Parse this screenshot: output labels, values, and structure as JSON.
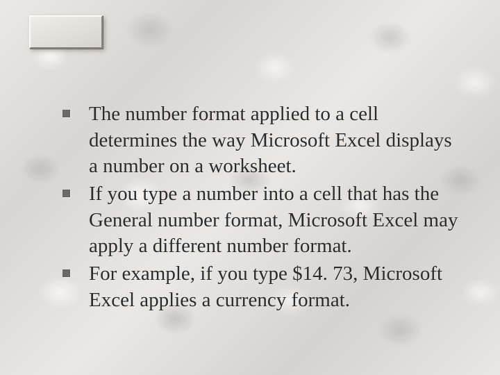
{
  "bullets": [
    "The number format applied to a cell determines the way Microsoft Excel displays a number on a worksheet.",
    "If you type a number into a cell that has the General number format, Microsoft Excel may apply a different number format.",
    "For example, if you type $14. 73, Microsoft Excel applies a currency format."
  ]
}
